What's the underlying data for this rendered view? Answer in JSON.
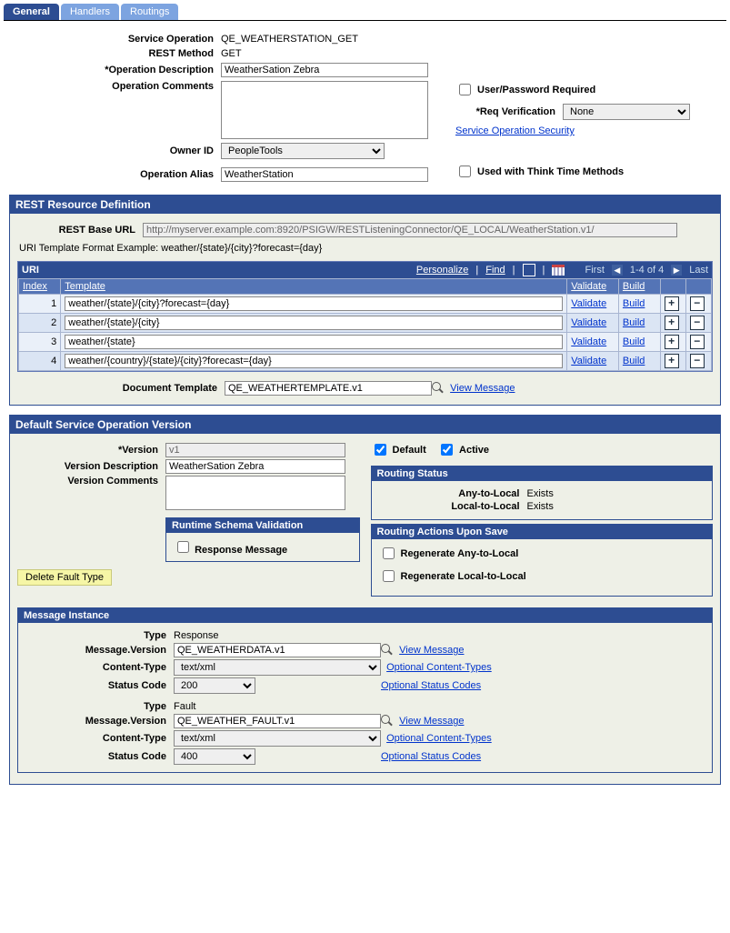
{
  "tabs": {
    "general": "General",
    "handlers": "Handlers",
    "routings": "Routings"
  },
  "labels": {
    "service_operation": "Service Operation",
    "rest_method": "REST Method",
    "operation_description": "*Operation Description",
    "operation_comments": "Operation Comments",
    "owner_id": "Owner ID",
    "operation_alias": "Operation Alias",
    "user_pw_required": "User/Password Required",
    "req_verification": "*Req Verification",
    "sos_link": "Service Operation Security",
    "used_think_time": "Used with Think Time Methods",
    "rest_base_url": "REST Base URL",
    "uri_example": "URI Template Format Example: weather/{state}/{city}?forecast={day}",
    "doc_template": "Document Template",
    "view_message": "View Message",
    "version": "*Version",
    "version_description": "Version Description",
    "version_comments": "Version Comments",
    "default": "Default",
    "active": "Active",
    "runtime_schema": "Runtime Schema Validation",
    "response_message": "Response Message",
    "delete_fault": "Delete Fault Type",
    "routing_status": "Routing Status",
    "any_to_local": "Any-to-Local",
    "local_to_local": "Local-to-Local",
    "routing_actions": "Routing Actions Upon Save",
    "regen_any": "Regenerate Any-to-Local",
    "regen_local": "Regenerate Local-to-Local",
    "type": "Type",
    "message_version": "Message.Version",
    "content_type": "Content-Type",
    "status_code": "Status Code",
    "opt_content": "Optional Content-Types",
    "opt_status": "Optional Status Codes",
    "personalize": "Personalize",
    "find": "Find",
    "first": "First",
    "last": "Last",
    "range": "1-4 of 4",
    "link_validate": "Validate",
    "link_build": "Build",
    "col_index": "Index",
    "col_template": "Template",
    "col_validate": "Validate",
    "col_build": "Build"
  },
  "values": {
    "service_operation": "QE_WEATHERSTATION_GET",
    "rest_method": "GET",
    "operation_description": "WeatherSation Zebra",
    "owner_id": "PeopleTools",
    "operation_alias": "WeatherStation",
    "req_verification": "None",
    "rest_base_url": "http://myserver.example.com:8920/PSIGW/RESTListeningConnector/QE_LOCAL/WeatherStation.v1/",
    "doc_template": "QE_WEATHERTEMPLATE.v1",
    "version": "v1",
    "version_description": "WeatherSation Zebra",
    "any_to_local_status": "Exists",
    "local_to_local_status": "Exists"
  },
  "section_titles": {
    "rest_def": "REST Resource Definition",
    "uri": "URI",
    "default_version": "Default Service Operation Version",
    "message_instance": "Message Instance"
  },
  "uri_rows": [
    {
      "index": "1",
      "template": "weather/{state}/{city}?forecast={day}"
    },
    {
      "index": "2",
      "template": "weather/{state}/{city}"
    },
    {
      "index": "3",
      "template": "weather/{state}"
    },
    {
      "index": "4",
      "template": "weather/{country}/{state}/{city}?forecast={day}"
    }
  ],
  "messages": {
    "response": {
      "type": "Response",
      "message_version": "QE_WEATHERDATA.v1",
      "content_type": "text/xml",
      "status_code": "200"
    },
    "fault": {
      "type": "Fault",
      "message_version": "QE_WEATHER_FAULT.v1",
      "content_type": "text/xml",
      "status_code": "400"
    }
  }
}
